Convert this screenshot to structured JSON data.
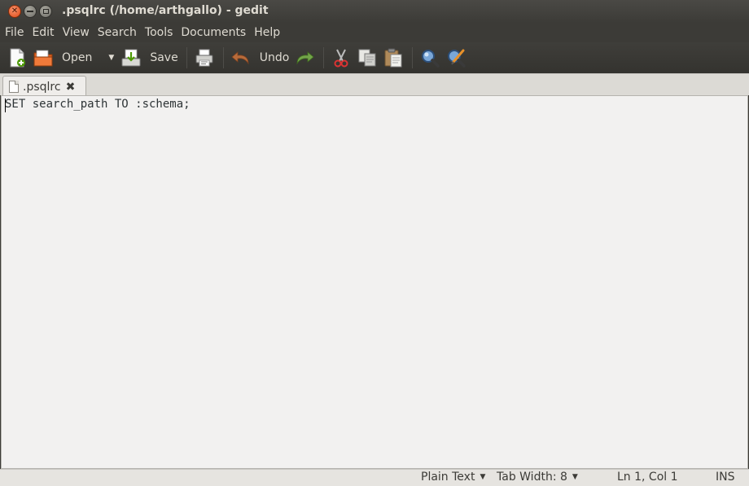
{
  "window": {
    "title": ".psqlrc (/home/arthgallo) - gedit"
  },
  "menu": [
    "File",
    "Edit",
    "View",
    "Search",
    "Tools",
    "Documents",
    "Help"
  ],
  "toolbar": {
    "open_label": "Open",
    "save_label": "Save",
    "undo_label": "Undo"
  },
  "tab": {
    "label": ".psqlrc",
    "close_glyph": "✖"
  },
  "editor": {
    "line1": "SET search_path TO :schema;"
  },
  "statusbar": {
    "language": "Plain Text",
    "tab_width": "Tab Width: 8",
    "position": "Ln 1, Col 1",
    "mode": "INS"
  },
  "colors": {
    "accent_close": "#df4a16",
    "chrome": "#3c3b37",
    "editor_bg": "#f2f1f0"
  }
}
